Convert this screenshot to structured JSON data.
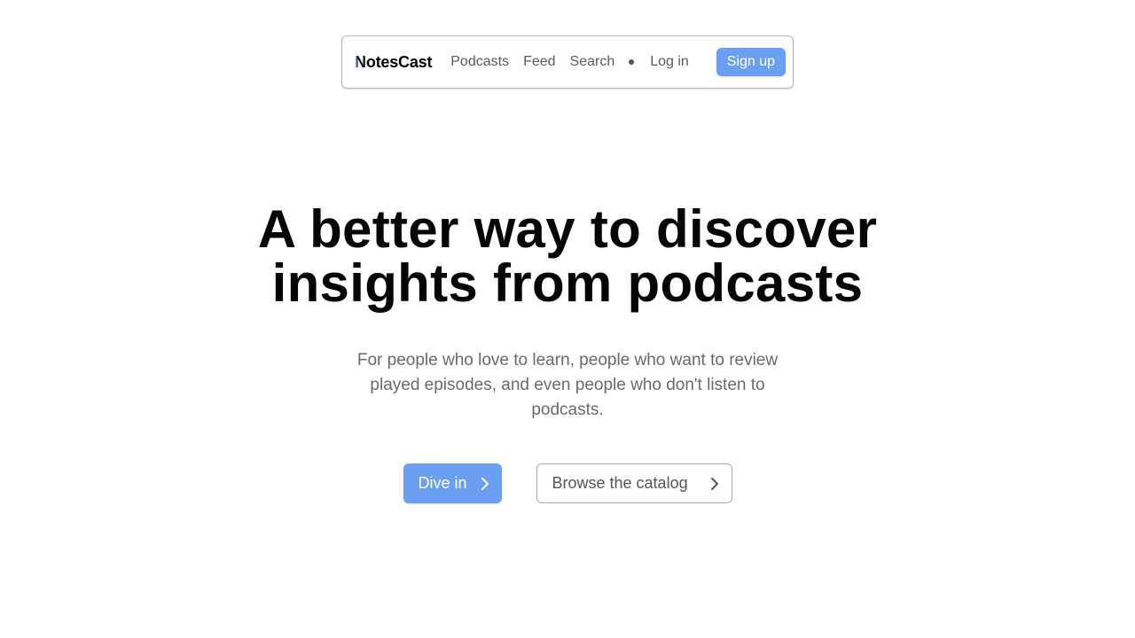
{
  "nav": {
    "logo_first": "N",
    "logo_rest": "otesCast",
    "links": [
      "Podcasts",
      "Feed",
      "Search"
    ],
    "login": "Log in",
    "signup": "Sign up",
    "accent_color": "#6b9ff2"
  },
  "hero": {
    "title_line1": "A better way to discover",
    "title_line2": "insights from podcasts",
    "subtitle": "For people who love to learn, people who want to review played episodes, and even people who don't listen to podcasts.",
    "primary_cta": "Dive in",
    "secondary_cta": "Browse the catalog"
  }
}
